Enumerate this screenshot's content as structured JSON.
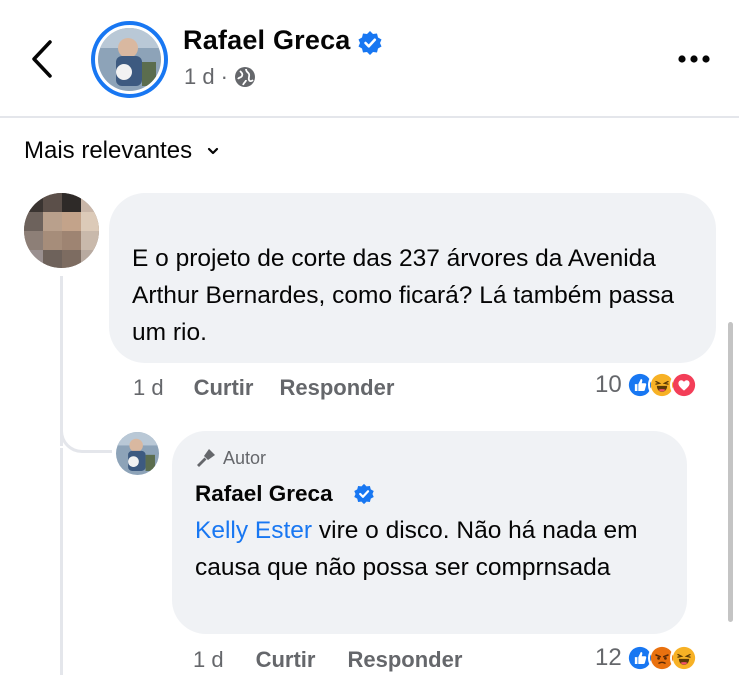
{
  "header": {
    "back_icon": "chevron-left-icon",
    "author_name": "Rafael Greca",
    "time": "1 d",
    "separator": "·",
    "audience_icon": "globe-icon",
    "more_icon": "more-horizontal-icon"
  },
  "sort": {
    "label": "Mais relevantes",
    "icon": "chevron-down-icon"
  },
  "comment": {
    "text": "E o projeto de corte das 237 árvores da Avenida Arthur Bernardes,  como ficará? Lá também passa um rio.",
    "time": "1 d",
    "like_label": "Curtir",
    "reply_label": "Responder",
    "reaction_count": "10",
    "reactions": [
      "like",
      "haha",
      "love"
    ]
  },
  "reply": {
    "badge": "Autor",
    "badge_icon": "microphone-icon",
    "author_name": "Rafael Greca",
    "mention": "Kelly Ester",
    "text": " vire o disco. Não há nada em causa que não possa ser comprnsada",
    "time": "1 d",
    "like_label": "Curtir",
    "reply_label": "Responder",
    "reaction_count": "12",
    "reactions": [
      "like",
      "angry",
      "haha"
    ]
  },
  "colors": {
    "accent": "#1877f2",
    "bubble": "#f0f2f5",
    "muted": "#65676b"
  }
}
